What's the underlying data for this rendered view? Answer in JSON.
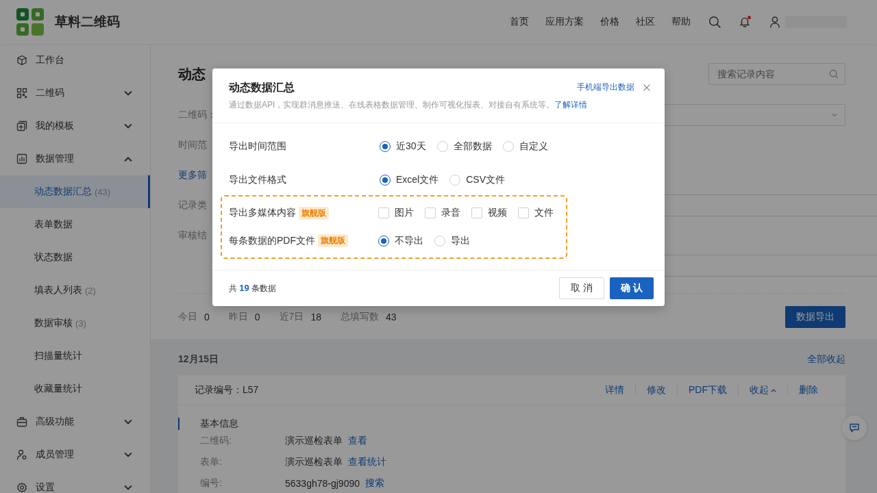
{
  "header": {
    "logo_text": "草料二维码",
    "nav": [
      "首页",
      "应用方案",
      "价格",
      "社区",
      "帮助"
    ],
    "notification_dot": true
  },
  "sidebar": {
    "items": [
      {
        "label": "工作台"
      },
      {
        "label": "二维码",
        "expanded": false
      },
      {
        "label": "我的模板",
        "expanded": false
      },
      {
        "label": "数据管理",
        "expanded": true,
        "children": [
          {
            "label": "动态数据汇总",
            "count": "(43)",
            "selected": true
          },
          {
            "label": "表单数据",
            "selected": false
          },
          {
            "label": "状态数据",
            "selected": false
          },
          {
            "label": "填表人列表",
            "count": "(2)",
            "selected": false
          },
          {
            "label": "数据审核",
            "count": "(3)",
            "selected": false
          },
          {
            "label": "扫描量统计",
            "selected": false
          },
          {
            "label": "收藏量统计",
            "selected": false
          }
        ]
      },
      {
        "label": "高级功能",
        "expanded": false
      },
      {
        "label": "成员管理",
        "expanded": false
      },
      {
        "label": "设置",
        "expanded": false
      }
    ]
  },
  "page": {
    "title": "动态",
    "search": {
      "placeholder": "搜索记录内容"
    },
    "filters": [
      {
        "kind": "select",
        "label": "二维码："
      },
      {
        "kind": "text",
        "label": "时间范"
      },
      {
        "kind": "link",
        "label": "更多筛"
      },
      {
        "kind": "select",
        "label": "记录类"
      },
      {
        "kind": "text",
        "label": "审核结"
      },
      {
        "kind": "select"
      }
    ],
    "stats": [
      {
        "label": "今日",
        "value": "0"
      },
      {
        "label": "昨日",
        "value": "0"
      },
      {
        "label": "近7日",
        "value": "18"
      },
      {
        "label": "总填写数",
        "value": "43"
      }
    ],
    "export_button": "数据导出",
    "date": "12月15日",
    "collapse_all": "全部收起",
    "record": {
      "id": "记录编号：L57",
      "actions": [
        {
          "label": "详情"
        },
        {
          "label": "修改"
        },
        {
          "label": "PDF下载"
        },
        {
          "label": "收起",
          "caret": true
        },
        {
          "label": "删除"
        }
      ],
      "section": "基本信息",
      "fields": [
        {
          "label": "二维码:",
          "value": "演示巡检表单",
          "link": "查看"
        },
        {
          "label": "表单:",
          "value": "演示巡检表单",
          "link": "查看统计"
        },
        {
          "label": "编号:",
          "value": "5633gh78-gj9090",
          "link": "搜索"
        }
      ]
    }
  },
  "modal": {
    "title": "动态数据汇总",
    "subtitle": "通过数据API，实现群消息推送、在线表格数据管理、制作可视化报表、对接自有系统等。",
    "subtitle_link": "了解详情",
    "top_link": "手机端导出数据",
    "rows": [
      {
        "kind": "radio",
        "label": "导出时间范围",
        "options": [
          {
            "label": "近30天",
            "selected": true
          },
          {
            "label": "全部数据",
            "selected": false
          },
          {
            "label": "自定义",
            "selected": false
          }
        ]
      },
      {
        "kind": "radio",
        "label": "导出文件格式",
        "options": [
          {
            "label": "Excel文件",
            "selected": true
          },
          {
            "label": "CSV文件",
            "selected": false
          }
        ]
      }
    ],
    "premium_rows": [
      {
        "kind": "checkbox",
        "label": "导出多媒体内容",
        "badge": "旗舰版",
        "options": [
          {
            "label": "图片",
            "checked": false
          },
          {
            "label": "录音",
            "checked": false
          },
          {
            "label": "视频",
            "checked": false
          },
          {
            "label": "文件",
            "checked": false
          }
        ]
      },
      {
        "kind": "radio",
        "label": "每条数据的PDF文件",
        "badge": "旗舰版",
        "options": [
          {
            "label": "不导出",
            "selected": true
          },
          {
            "label": "导出",
            "selected": false
          }
        ]
      }
    ],
    "summary": "共 **19** 条数据",
    "cancel": "取 消",
    "confirm": "确 认"
  }
}
